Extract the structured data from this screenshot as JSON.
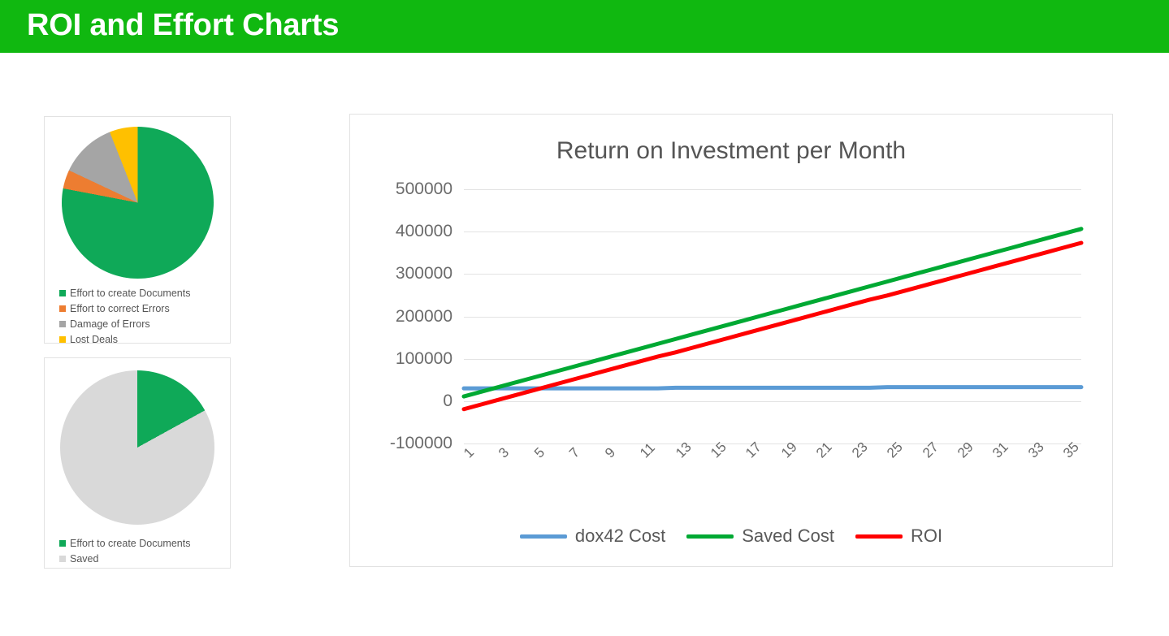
{
  "header": {
    "title": "ROI and Effort Charts",
    "bar_color": "#10b810",
    "text_color": "#ffffff"
  },
  "colors": {
    "green": "#0fa958",
    "orange": "#ed7d31",
    "gray": "#a5a5a5",
    "yellow": "#ffc000",
    "light_gray": "#d9d9d9",
    "line_blue": "#5b9bd5",
    "line_green": "#00a933",
    "line_red": "#ff0000",
    "axis_text": "#6b6b6b",
    "gridline": "#e3e3e3",
    "panel_border": "#e2e2e2"
  },
  "pie_one": {
    "name": "effort-breakdown-pie",
    "legend": [
      {
        "label": "Effort to create Documents",
        "color": "#0fa958",
        "value": 78
      },
      {
        "label": "Effort to correct Errors",
        "color": "#ed7d31",
        "value": 4
      },
      {
        "label": "Damage of Errors",
        "color": "#a5a5a5",
        "value": 12
      },
      {
        "label": "Lost Deals",
        "color": "#ffc000",
        "value": 6
      }
    ]
  },
  "pie_two": {
    "name": "savings-pie",
    "legend": [
      {
        "label": "Effort to create Documents",
        "color": "#0fa958",
        "value": 17
      },
      {
        "label": "Saved",
        "color": "#d9d9d9",
        "value": 83
      }
    ]
  },
  "chart_data": {
    "type": "line",
    "title": "Return on Investment per Month",
    "xlabel": "",
    "ylabel": "",
    "grid": true,
    "legend_position": "bottom",
    "ylim": [
      -100000,
      500000
    ],
    "ytick_labels": [
      "500000",
      "400000",
      "300000",
      "200000",
      "100000",
      "0",
      "-100000"
    ],
    "yticks": [
      500000,
      400000,
      300000,
      200000,
      100000,
      0,
      -100000
    ],
    "xlim": [
      1,
      36
    ],
    "xtick_labels": [
      "1",
      "3",
      "5",
      "7",
      "9",
      "11",
      "13",
      "15",
      "17",
      "19",
      "21",
      "23",
      "25",
      "27",
      "29",
      "31",
      "33",
      "35"
    ],
    "xticks": [
      1,
      3,
      5,
      7,
      9,
      11,
      13,
      15,
      17,
      19,
      21,
      23,
      25,
      27,
      29,
      31,
      33,
      35
    ],
    "x": [
      1,
      2,
      3,
      4,
      5,
      6,
      7,
      8,
      9,
      10,
      11,
      12,
      13,
      14,
      15,
      16,
      17,
      18,
      19,
      20,
      21,
      22,
      23,
      24,
      25,
      26,
      27,
      28,
      29,
      30,
      31,
      32,
      33,
      34,
      35,
      36
    ],
    "series": [
      {
        "name": "dox42 Cost",
        "color": "#5b9bd5",
        "values": [
          30000,
          30000,
          30000,
          30000,
          30000,
          30000,
          30000,
          30000,
          30000,
          30000,
          30000,
          30000,
          31500,
          31500,
          31500,
          31500,
          31500,
          31500,
          31500,
          31500,
          31500,
          31500,
          31500,
          31500,
          33000,
          33000,
          33000,
          33000,
          33000,
          33000,
          33000,
          33000,
          33000,
          33000,
          33000,
          33000
        ]
      },
      {
        "name": "Saved Cost",
        "color": "#00a933",
        "values": [
          11000,
          22300,
          33600,
          44900,
          56200,
          67500,
          78800,
          90100,
          101400,
          112700,
          124000,
          135300,
          146600,
          157900,
          169200,
          180500,
          191800,
          203100,
          214400,
          225700,
          237000,
          248300,
          259600,
          270900,
          282200,
          293500,
          304800,
          316100,
          327400,
          338700,
          350000,
          361300,
          372600,
          383900,
          395200,
          406500
        ]
      },
      {
        "name": "ROI",
        "color": "#ff0000",
        "values": [
          -19000,
          -7700,
          3600,
          14900,
          26200,
          37500,
          48800,
          60100,
          71400,
          82700,
          94000,
          105300,
          115100,
          126400,
          137700,
          149000,
          160300,
          171600,
          182900,
          194200,
          205500,
          216800,
          228100,
          239400,
          249200,
          260500,
          271800,
          283100,
          294400,
          305700,
          317000,
          328300,
          339600,
          350900,
          362200,
          373500
        ]
      }
    ]
  }
}
